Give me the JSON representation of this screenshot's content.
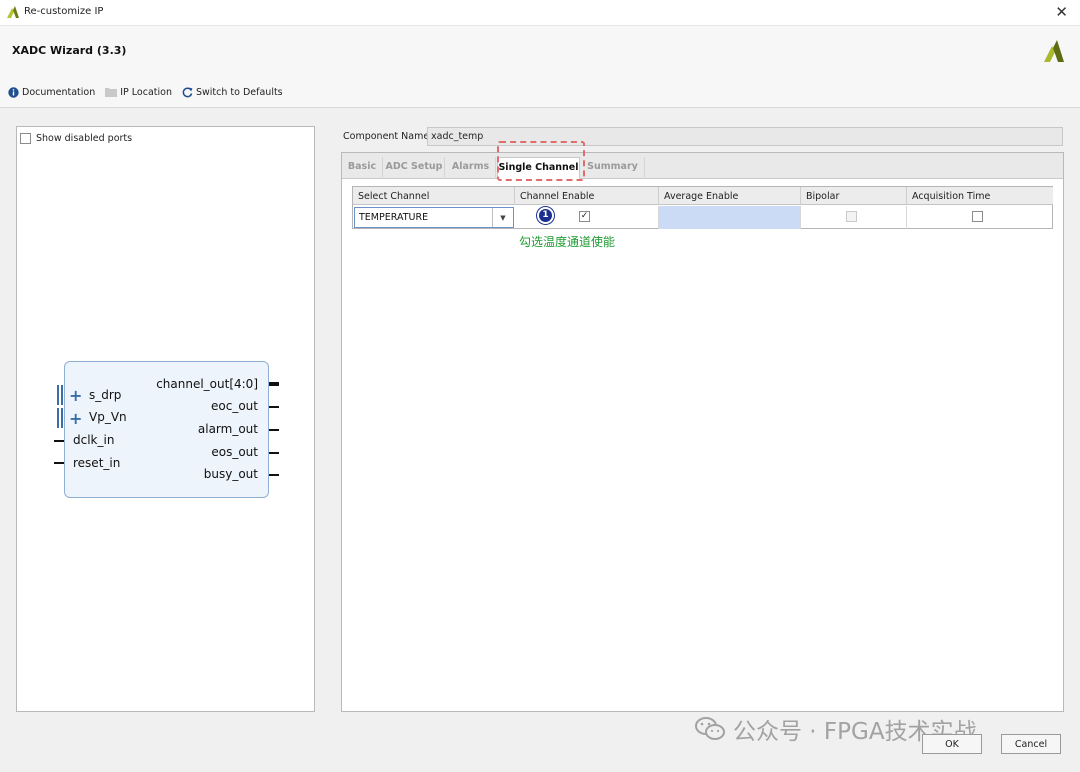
{
  "window": {
    "title": "Re-customize IP"
  },
  "header": {
    "wizard_title": "XADC Wizard (3.3)"
  },
  "toolbar": {
    "documentation": "Documentation",
    "ip_location": "IP Location",
    "switch_defaults": "Switch to Defaults"
  },
  "left_panel": {
    "show_disabled_ports": "Show disabled ports",
    "ports_left": [
      "s_drp",
      "Vp_Vn",
      "dclk_in",
      "reset_in"
    ],
    "ports_right": [
      "channel_out[4:0]",
      "eoc_out",
      "alarm_out",
      "eos_out",
      "busy_out"
    ]
  },
  "component": {
    "label": "Component Name",
    "value": "xadc_temp"
  },
  "tabs": [
    "Basic",
    "ADC Setup",
    "Alarms",
    "Single Channel",
    "Summary"
  ],
  "active_tab": "Single Channel",
  "table": {
    "headers": [
      "Select Channel",
      "Channel Enable",
      "Average Enable",
      "Bipolar",
      "Acquisition Time"
    ],
    "row": {
      "select_channel": "TEMPERATURE",
      "channel_enable": true,
      "bipolar": false,
      "acquisition_time": false
    }
  },
  "annotation": {
    "badge": "1",
    "text": "勾选温度通道使能"
  },
  "watermark": "公众号 · FPGA技术实战",
  "buttons": {
    "ok": "OK",
    "cancel": "Cancel"
  },
  "colors": {
    "accent": "#3a6ea8",
    "highlight": "#e26b6b",
    "annotation": "#1f9b32",
    "badge": "#1a2e8f"
  }
}
